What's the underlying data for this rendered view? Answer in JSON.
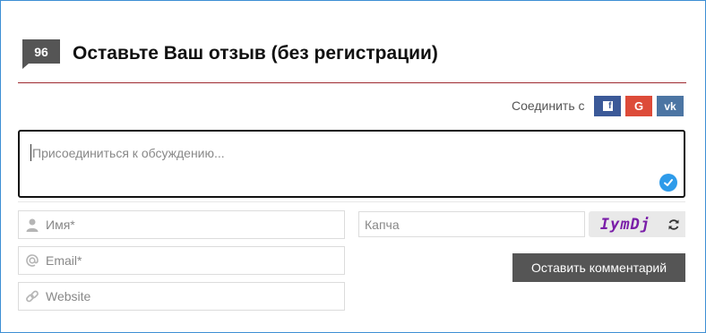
{
  "comments": {
    "count": "96",
    "title": "Оставьте Ваш отзыв (без регистрации)"
  },
  "social_login": {
    "label": "Соединить с",
    "providers": [
      {
        "name": "facebook",
        "glyph": "f",
        "color": "#3b5998"
      },
      {
        "name": "google",
        "glyph": "G",
        "color": "#dd4b39"
      },
      {
        "name": "vk",
        "glyph": "vk",
        "color": "#4c75a3"
      }
    ]
  },
  "comment_box": {
    "placeholder": "Присоединиться к обсуждению..."
  },
  "fields": {
    "name": {
      "placeholder": "Имя*",
      "icon": "user-icon"
    },
    "email": {
      "placeholder": "Email*",
      "icon": "at-icon"
    },
    "website": {
      "placeholder": "Website",
      "icon": "link-icon"
    }
  },
  "captcha": {
    "placeholder": "Капча",
    "code": "IymDj"
  },
  "submit": {
    "label": "Оставить комментарий"
  },
  "colors": {
    "accent_dark": "#555555",
    "divider": "#9e2a2f",
    "check": "#2e9bea",
    "captcha_text": "#7a1ea8"
  }
}
